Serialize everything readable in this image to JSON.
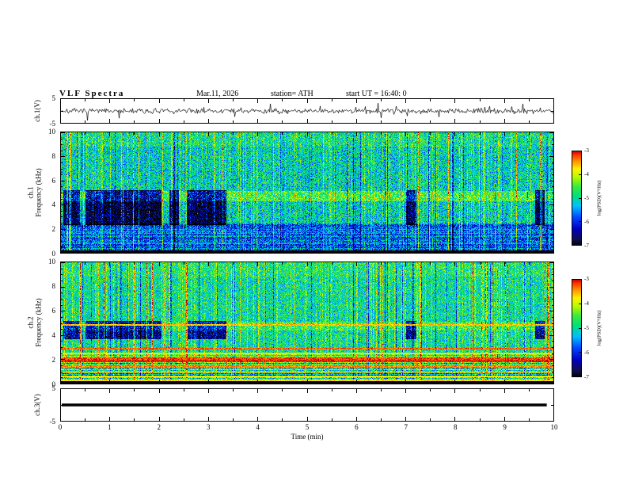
{
  "header": {
    "title": "VLF  Spectra",
    "date": "Mar.11, 2026",
    "station": "station= ATH",
    "start_ut": "start UT =  16:40: 0"
  },
  "x_axis": {
    "label": "Time  (min)",
    "range": [
      0,
      10
    ],
    "ticks": [
      0,
      1,
      2,
      3,
      4,
      5,
      6,
      7,
      8,
      9,
      10
    ]
  },
  "colorbar": {
    "label": "log(PSD)(V²/Hz)",
    "range": [
      -7,
      -3
    ],
    "ticks": [
      -3,
      -4,
      -5,
      -6,
      -7
    ]
  },
  "chart_data": [
    {
      "type": "line",
      "panel": "ch1-waveform",
      "ylabel": "ch.1(V)",
      "xlim": [
        0,
        10
      ],
      "ylim": [
        -5,
        5
      ],
      "yticks": [
        5,
        -5
      ],
      "description": "Broadband noise around 0 V with impulsive spikes to about ±4 V",
      "seed": 7,
      "noise_amp": 0.6,
      "spike_prob": 0.035,
      "spike_amp": 2.8
    },
    {
      "type": "heatmap",
      "panel": "ch1-spectrogram",
      "ylabel_lines": [
        "ch.1",
        "Frequency (kHz)"
      ],
      "xlim": [
        0,
        10
      ],
      "ylim": [
        0,
        10
      ],
      "yticks": [
        0,
        2,
        4,
        6,
        8,
        10
      ],
      "zlim": [
        -7,
        -3
      ],
      "seed": 101,
      "base": -5.15,
      "noise": 0.75,
      "bands": [
        {
          "f": [
            0.3,
            2.5
          ],
          "dv": -0.6
        },
        {
          "f": [
            4.35,
            5.15
          ],
          "dv": 0.55
        },
        {
          "f": [
            8.8,
            10
          ],
          "dv": 0.2
        }
      ],
      "bottom_black": 0.3,
      "row_band": 2.5,
      "row_amp": 0.45,
      "blue_band": [
        2.35,
        5.2
      ],
      "blue_dv": -1.8,
      "blue_regions": [
        [
          0.05,
          0.4
        ],
        [
          0.5,
          2.05
        ],
        [
          2.2,
          2.4
        ],
        [
          2.55,
          3.35
        ],
        [
          7.0,
          7.2
        ],
        [
          9.6,
          9.8
        ]
      ],
      "streak_damp": [
        [
          3.4,
          5.7,
          0.55
        ]
      ],
      "hlines": []
    },
    {
      "type": "heatmap",
      "panel": "ch2-spectrogram",
      "ylabel_lines": [
        "ch.2",
        "Frequency (kHz)"
      ],
      "xlim": [
        0,
        10
      ],
      "ylim": [
        0,
        10
      ],
      "yticks": [
        0,
        2,
        4,
        6,
        8,
        10
      ],
      "zlim": [
        -7,
        -3
      ],
      "seed": 202,
      "base": -5.0,
      "noise": 0.7,
      "bands": [
        {
          "f": [
            0.28,
            2.6
          ],
          "dv": 0.05
        },
        {
          "f": [
            4.4,
            5.15
          ],
          "dv": 0.35
        },
        {
          "f": [
            8.8,
            10
          ],
          "dv": 0.15
        }
      ],
      "bottom_black": 0.28,
      "row_band": 2.6,
      "row_amp": 1.1,
      "blue_band": [
        3.7,
        5.2
      ],
      "blue_dv": -1.55,
      "blue_regions": [
        [
          0.05,
          0.4
        ],
        [
          0.5,
          2.05
        ],
        [
          2.55,
          3.35
        ],
        [
          7.0,
          7.2
        ],
        [
          9.6,
          9.8
        ]
      ],
      "streak_damp": [
        [
          3.4,
          5.7,
          0.7
        ]
      ],
      "hlines": [
        {
          "f": 0.38,
          "v": -3.7,
          "wd": 0.07
        },
        {
          "f": 0.68,
          "v": -3.8,
          "wd": 0.06
        },
        {
          "f": 1.06,
          "v": -3.5,
          "wd": 0.07
        },
        {
          "f": 1.48,
          "v": -3.4,
          "wd": 0.08
        },
        {
          "f": 1.92,
          "v": -3.1,
          "wd": 0.1
        },
        {
          "f": 2.12,
          "v": -3.2,
          "wd": 0.09
        },
        {
          "f": 2.55,
          "v": -3.8,
          "wd": 0.06
        },
        {
          "f": 2.95,
          "v": -3.3,
          "wd": 0.08
        },
        {
          "f": 4.88,
          "v": -3.6,
          "wd": 0.07
        }
      ]
    },
    {
      "type": "line",
      "panel": "ch3-waveform",
      "ylabel": "ch.3(V)",
      "xlim": [
        0,
        10
      ],
      "ylim": [
        -5,
        5
      ],
      "yticks": [
        5,
        -5
      ],
      "description": "Constant 0 V thick trace ending near 9.85 min",
      "value": 0,
      "end_min": 9.85
    }
  ]
}
